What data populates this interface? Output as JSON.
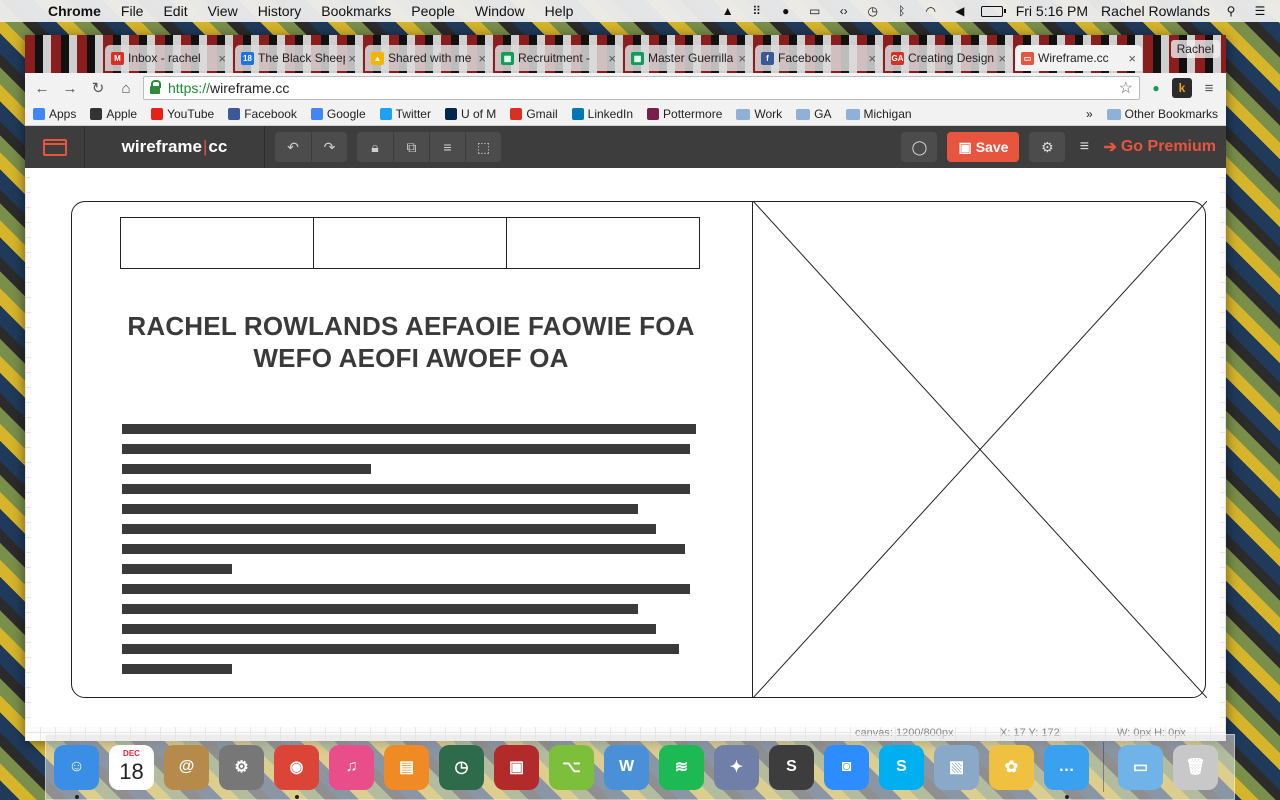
{
  "menubar": {
    "app_name": "Chrome",
    "menus": [
      "File",
      "Edit",
      "View",
      "History",
      "Bookmarks",
      "People",
      "Window",
      "Help"
    ],
    "clock": "Fri 5:16 PM",
    "user": "Rachel Rowlands"
  },
  "browser": {
    "tabs": [
      {
        "title": "Inbox - rachel",
        "favicon_color": "#d93025",
        "favicon_glyph": "M"
      },
      {
        "title": "The Black Sheep",
        "favicon_color": "#1a73e8",
        "favicon_glyph": "18"
      },
      {
        "title": "Shared with me",
        "favicon_color": "#f4b400",
        "favicon_glyph": "▲"
      },
      {
        "title": "Recruitment -",
        "favicon_color": "#0f9d58",
        "favicon_glyph": "▦"
      },
      {
        "title": "Master Guerrilla",
        "favicon_color": "#0f9d58",
        "favicon_glyph": "▦"
      },
      {
        "title": "Facebook",
        "favicon_color": "#3b5998",
        "favicon_glyph": "f"
      },
      {
        "title": "Creating Design",
        "favicon_color": "#d93025",
        "favicon_glyph": "GA"
      },
      {
        "title": "Wireframe.cc",
        "favicon_color": "#e8553e",
        "favicon_glyph": "▭",
        "active": true
      }
    ],
    "profile": "Rachel",
    "url_scheme": "https://",
    "url_host": "wireframe.cc",
    "bookmarks": [
      {
        "label": "Apps",
        "color": "#4285f4"
      },
      {
        "label": "Apple",
        "color": "#333333"
      },
      {
        "label": "YouTube",
        "color": "#e62117"
      },
      {
        "label": "Facebook",
        "color": "#3b5998"
      },
      {
        "label": "Google",
        "color": "#4285f4"
      },
      {
        "label": "Twitter",
        "color": "#1da1f2"
      },
      {
        "label": "U of M",
        "color": "#00274c"
      },
      {
        "label": "Gmail",
        "color": "#d93025"
      },
      {
        "label": "LinkedIn",
        "color": "#0077b5"
      },
      {
        "label": "Pottermore",
        "color": "#7a1f4a"
      },
      {
        "label": "Work",
        "folder": true
      },
      {
        "label": "GA",
        "folder": true
      },
      {
        "label": "Michigan",
        "folder": true
      }
    ],
    "bookmarks_overflow": "»",
    "other_bookmarks": "Other Bookmarks"
  },
  "app": {
    "brand_left": "wireframe",
    "brand_sep": "|",
    "brand_right": "cc",
    "save_label": "Save",
    "premium_label": "Go Premium",
    "accent": "#e8553e"
  },
  "wireframe": {
    "heading": "RACHEL ROWLANDS AEFAOIE FAOWIE FOA WEFO AEOFI AWOEF OA",
    "tab_count": 3,
    "text_lines": [
      0.99,
      0.98,
      0.43,
      0.98,
      0.89,
      0.92,
      0.97,
      0.19,
      0.98,
      0.89,
      0.92,
      0.96,
      0.19
    ]
  },
  "statusbar": {
    "canvas": "canvas: 1200/800px",
    "coords": "X: 17 Y: 172",
    "size": "W: 0px H: 0px"
  },
  "dock": {
    "calendar_month": "DEC",
    "calendar_day": "18",
    "apps": [
      {
        "name": "finder",
        "color": "#3a8ee6",
        "glyph": "☺",
        "running": true
      },
      {
        "name": "calendar"
      },
      {
        "name": "contacts",
        "color": "#b58a4a",
        "glyph": "@"
      },
      {
        "name": "system-preferences",
        "color": "#777777",
        "glyph": "⚙"
      },
      {
        "name": "chrome",
        "color": "#db4437",
        "glyph": "◉",
        "running": true
      },
      {
        "name": "itunes",
        "color": "#e94d8a",
        "glyph": "♫"
      },
      {
        "name": "ibooks",
        "color": "#f08a24",
        "glyph": "▤"
      },
      {
        "name": "time-machine",
        "color": "#2e6b4a",
        "glyph": "◷"
      },
      {
        "name": "photo-booth",
        "color": "#b32a2a",
        "glyph": "▣"
      },
      {
        "name": "sourcetree",
        "color": "#7bbf3a",
        "glyph": "⌥"
      },
      {
        "name": "wunderlist",
        "color": "#4a90d9",
        "glyph": "W"
      },
      {
        "name": "spotify",
        "color": "#1db954",
        "glyph": "≋"
      },
      {
        "name": "launchpad",
        "color": "#6f7fa8",
        "glyph": "✦"
      },
      {
        "name": "sublime-text",
        "color": "#3d3d3d",
        "glyph": "S"
      },
      {
        "name": "zoom",
        "color": "#2d8cff",
        "glyph": "◙"
      },
      {
        "name": "skype",
        "color": "#00aff0",
        "glyph": "S"
      },
      {
        "name": "preview",
        "color": "#8aa9c8",
        "glyph": "▧"
      },
      {
        "name": "photos",
        "color": "#f0c040",
        "glyph": "✿"
      },
      {
        "name": "messages",
        "color": "#3aa0f0",
        "glyph": "…",
        "running": true
      },
      {
        "name": "downloads-folder",
        "color": "#6fb3e8",
        "glyph": "▭",
        "after_divider": true
      },
      {
        "name": "trash",
        "color": "#c8c8c8",
        "glyph": "🗑"
      }
    ]
  }
}
